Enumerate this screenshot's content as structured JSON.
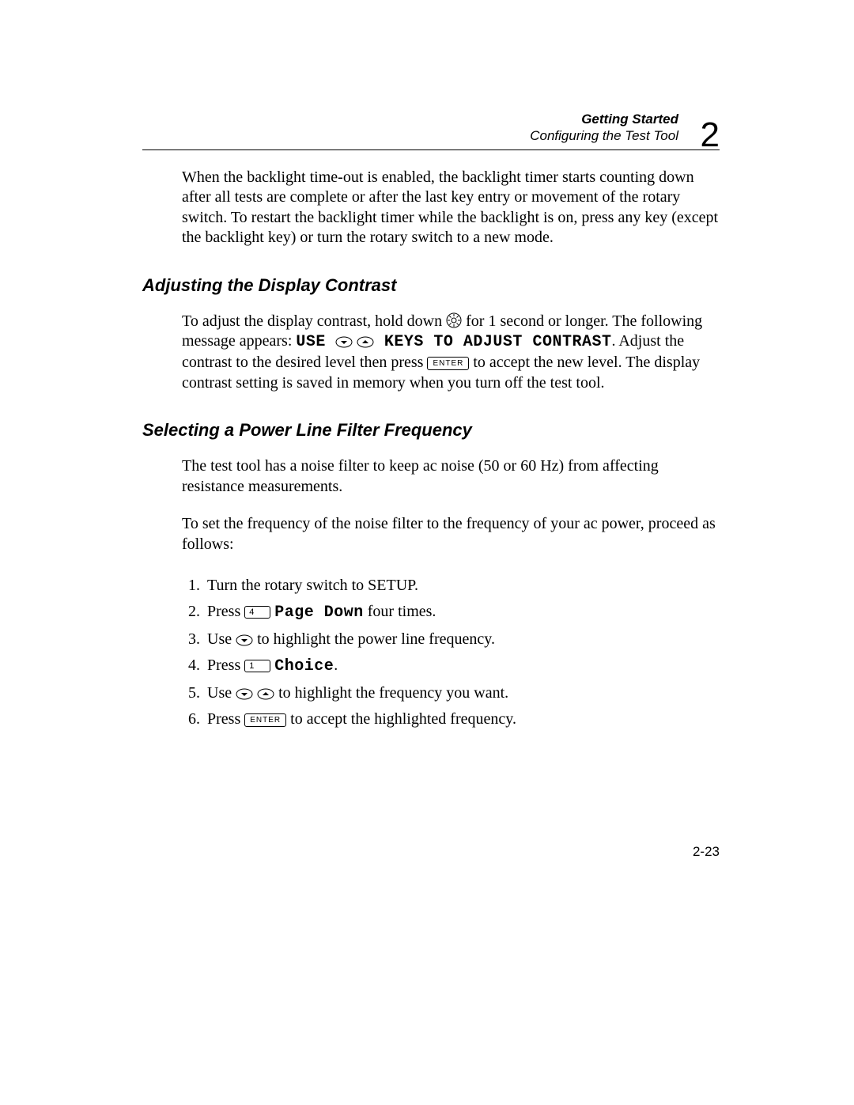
{
  "header": {
    "chapter_title": "Getting Started",
    "section_title": "Configuring the Test Tool",
    "chapter_number": "2"
  },
  "intro_paragraph": "When the backlight time-out is enabled, the backlight timer starts counting down after all tests are complete or after the last key entry or movement of the rotary switch. To restart the backlight timer while the backlight is on, press any key (except the backlight key) or turn the rotary switch to a new mode.",
  "section1": {
    "heading": "Adjusting the Display Contrast",
    "para_a": "To adjust the display contrast, hold down ",
    "para_b": " for 1 second or longer. The following message appears: ",
    "msg_use": "USE ",
    "msg_keys": " KEYS TO ADJUST CONTRAST",
    "para_c": ". Adjust the contrast to the desired level then press ",
    "enter_label": "ENTER",
    "para_d": " to accept the new level. The display contrast setting is saved in memory when you turn off the test tool."
  },
  "section2": {
    "heading": "Selecting a Power Line Filter Frequency",
    "para1": "The test tool has a noise filter to keep ac noise (50 or 60 Hz) from affecting resistance measurements.",
    "para2": "To set the frequency of the noise filter to the frequency of your ac power, proceed as follows:",
    "steps": {
      "s1": "Turn the rotary switch to SETUP.",
      "s2_a": "Press ",
      "s2_key": "4",
      "s2_label": "Page Down",
      "s2_b": " four times.",
      "s3_a": "Use ",
      "s3_b": " to highlight the power line frequency.",
      "s4_a": "Press ",
      "s4_key": "1",
      "s4_label": "Choice",
      "s4_b": ".",
      "s5_a": "Use ",
      "s5_b": " to highlight the frequency you want.",
      "s6_a": "Press ",
      "s6_key": "ENTER",
      "s6_b": " to accept the highlighted frequency."
    }
  },
  "page_number": "2-23"
}
